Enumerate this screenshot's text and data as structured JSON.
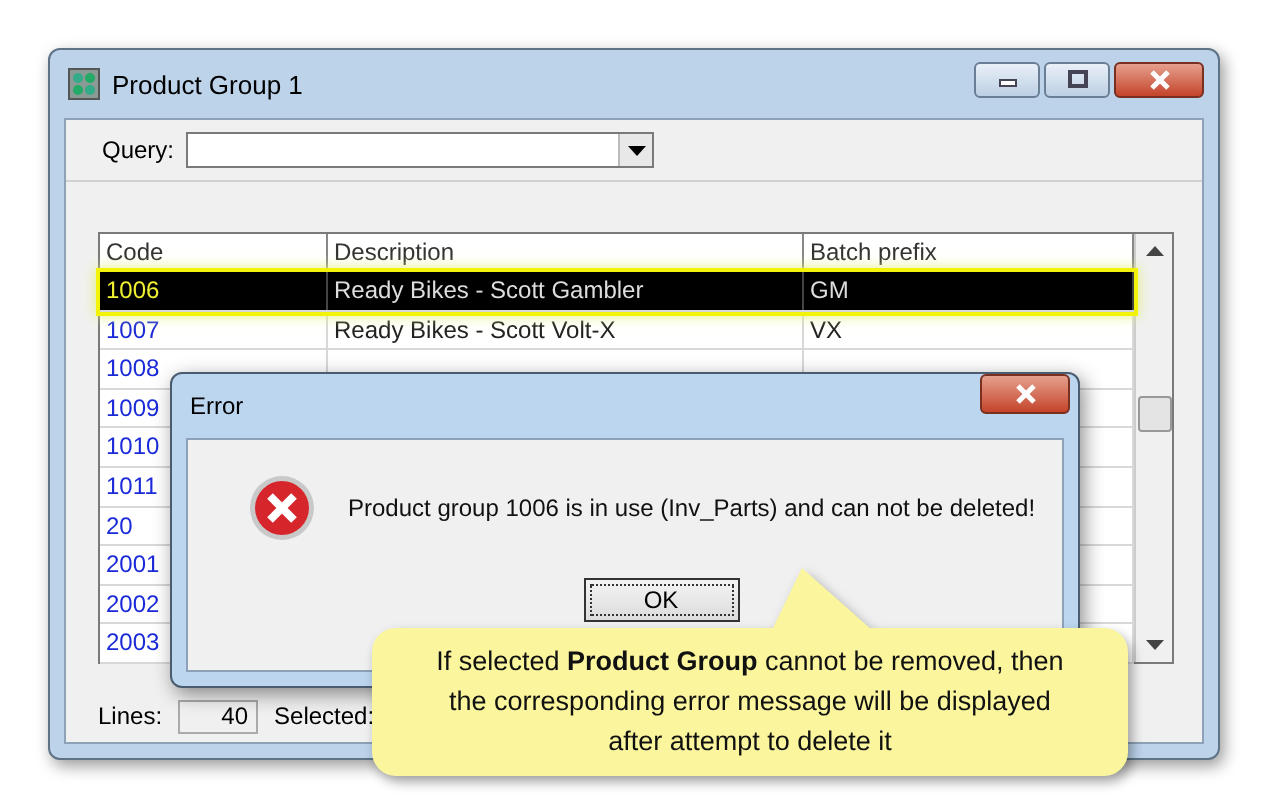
{
  "window": {
    "title": "Product Group 1"
  },
  "query": {
    "label": "Query:"
  },
  "table": {
    "columns": [
      "Code",
      "Description",
      "Batch prefix"
    ],
    "rows": [
      {
        "code": "1006",
        "description": "Ready Bikes - Scott Gambler",
        "batch_prefix": "GM",
        "selected": true
      },
      {
        "code": "1007",
        "description": "Ready Bikes - Scott Volt-X",
        "batch_prefix": "VX",
        "selected": false
      },
      {
        "code": "1008",
        "selected": false
      },
      {
        "code": "1009",
        "selected": false
      },
      {
        "code": "1010",
        "selected": false
      },
      {
        "code": "1011",
        "selected": false
      },
      {
        "code": "20",
        "selected": false
      },
      {
        "code": "2001",
        "selected": false
      },
      {
        "code": "2002",
        "selected": false
      },
      {
        "code": "2003",
        "selected": false
      }
    ]
  },
  "status_bar": {
    "lines_label": "Lines:",
    "lines_value": "40",
    "selected_label": "Selected:"
  },
  "dialog": {
    "title": "Error",
    "message": "Product group 1006 is in use (Inv_Parts) and can not be deleted!",
    "button": "OK"
  },
  "callout": {
    "text": "If selected **Product Group** cannot be removed, then the corresponding error message will be displayed after attempt to delete it"
  }
}
